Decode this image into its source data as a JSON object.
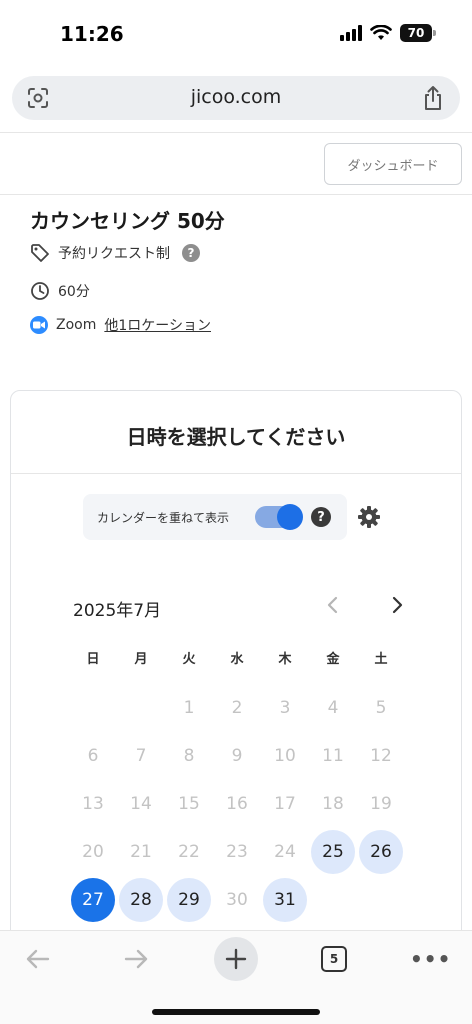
{
  "status_bar": {
    "time": "11:26",
    "battery": "70"
  },
  "browser": {
    "url": "jicoo.com",
    "tab_count": "5"
  },
  "header": {
    "dashboard_label": "ダッシュボード"
  },
  "event": {
    "title": "カウンセリング 50分",
    "booking_type": "予約リクエスト制",
    "duration": "60分",
    "location_prefix": "Zoom",
    "location_link": "他1ロケーション"
  },
  "calendar": {
    "heading": "日時を選択してください",
    "overlay_label": "カレンダーを重ねて表示",
    "overlay_enabled": true,
    "month_label": "2025年7月",
    "weekdays": [
      "日",
      "月",
      "火",
      "水",
      "木",
      "金",
      "土"
    ],
    "days": [
      {
        "d": ""
      },
      {
        "d": ""
      },
      {
        "d": "1"
      },
      {
        "d": "2"
      },
      {
        "d": "3"
      },
      {
        "d": "4"
      },
      {
        "d": "5"
      },
      {
        "d": "6"
      },
      {
        "d": "7"
      },
      {
        "d": "8"
      },
      {
        "d": "9"
      },
      {
        "d": "10"
      },
      {
        "d": "11"
      },
      {
        "d": "12"
      },
      {
        "d": "13"
      },
      {
        "d": "14"
      },
      {
        "d": "15"
      },
      {
        "d": "16"
      },
      {
        "d": "17"
      },
      {
        "d": "18"
      },
      {
        "d": "19"
      },
      {
        "d": "20"
      },
      {
        "d": "21"
      },
      {
        "d": "22"
      },
      {
        "d": "23"
      },
      {
        "d": "24"
      },
      {
        "d": "25",
        "state": "available"
      },
      {
        "d": "26",
        "state": "available"
      },
      {
        "d": "27",
        "state": "selected"
      },
      {
        "d": "28",
        "state": "available"
      },
      {
        "d": "29",
        "state": "available"
      },
      {
        "d": "30"
      },
      {
        "d": "31",
        "state": "available"
      }
    ]
  },
  "colors": {
    "accent": "#1a73e8",
    "available_bg": "#dde8fb",
    "disabled_text": "#c3c3c3",
    "zoom_blue": "#2d8cff"
  }
}
